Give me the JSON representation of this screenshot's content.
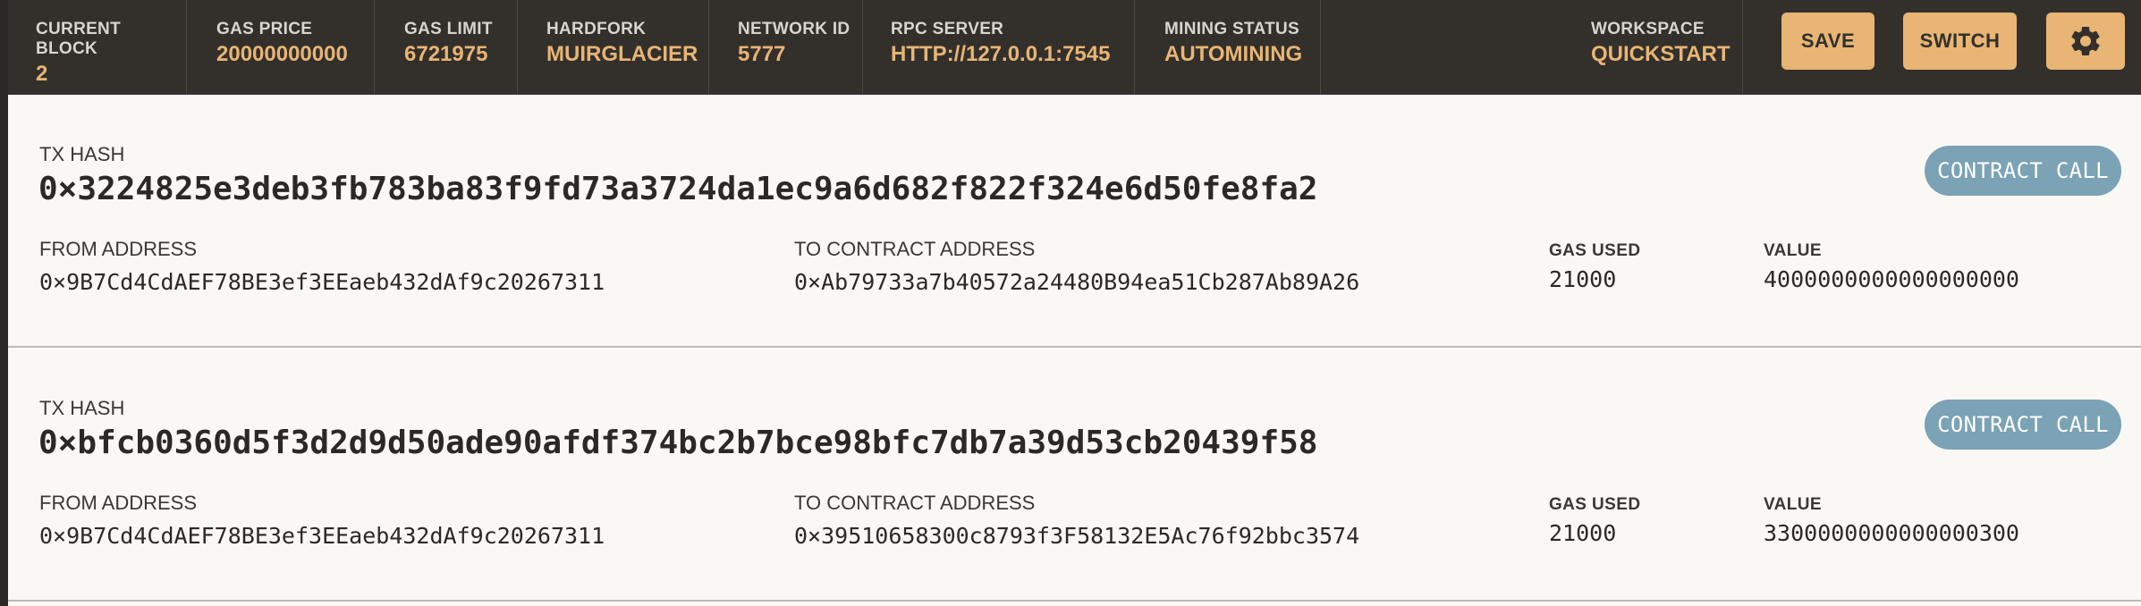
{
  "header": {
    "current_block": {
      "label": "CURRENT BLOCK",
      "value": "2"
    },
    "gas_price": {
      "label": "GAS PRICE",
      "value": "20000000000"
    },
    "gas_limit": {
      "label": "GAS LIMIT",
      "value": "6721975"
    },
    "hardfork": {
      "label": "HARDFORK",
      "value": "MUIRGLACIER"
    },
    "network_id": {
      "label": "NETWORK ID",
      "value": "5777"
    },
    "rpc_server": {
      "label": "RPC SERVER",
      "value": "HTTP://127.0.0.1:7545"
    },
    "mining_status": {
      "label": "MINING STATUS",
      "value": "AUTOMINING"
    },
    "workspace": {
      "label": "WORKSPACE",
      "value": "QUICKSTART"
    },
    "save_label": "SAVE",
    "switch_label": "SWITCH",
    "settings_icon": "gear-icon",
    "accent_color": "#e8b574",
    "bar_color": "#33302c"
  },
  "transactions": [
    {
      "hash_label": "TX HASH",
      "hash": "0×3224825e3deb3fb783ba83f9fd73a3724da1ec9a6d682f822f324e6d50fe8fa2",
      "badge": "CONTRACT CALL",
      "from_label": "FROM ADDRESS",
      "from": "0×9B7Cd4CdAEF78BE3ef3EEaeb432dAf9c20267311",
      "to_label": "TO CONTRACT ADDRESS",
      "to": "0×Ab79733a7b40572a24480B94ea51Cb287Ab89A26",
      "gas_label": "GAS USED",
      "gas": "21000",
      "value_label": "VALUE",
      "value": "4000000000000000000"
    },
    {
      "hash_label": "TX HASH",
      "hash": "0×bfcb0360d5f3d2d9d50ade90afdf374bc2b7bce98bfc7db7a39d53cb20439f58",
      "badge": "CONTRACT CALL",
      "from_label": "FROM ADDRESS",
      "from": "0×9B7Cd4CdAEF78BE3ef3EEaeb432dAf9c20267311",
      "to_label": "TO CONTRACT ADDRESS",
      "to": "0×39510658300c8793f3F58132E5Ac76f92bbc3574",
      "gas_label": "GAS USED",
      "gas": "21000",
      "value_label": "VALUE",
      "value": "3300000000000000300"
    }
  ],
  "badge_color": "#7ba2b5"
}
